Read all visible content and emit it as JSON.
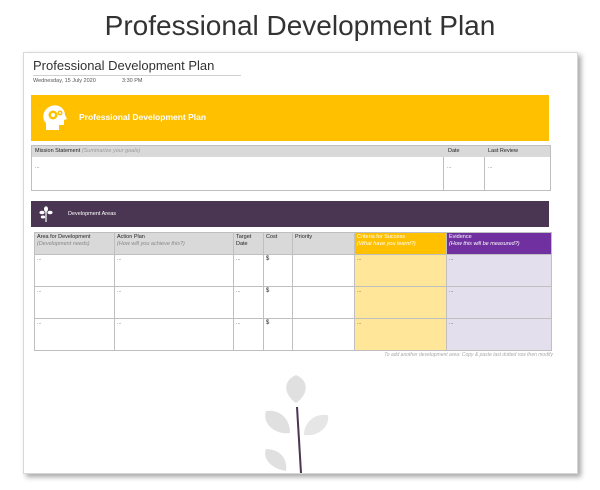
{
  "slide": {
    "title": "Professional Development Plan"
  },
  "doc": {
    "title": "Professional Development Plan",
    "date": "Wednesday, 15 July 2020",
    "time": "3:30 PM"
  },
  "banner": {
    "title": "Professional Development Plan",
    "icon": "head-gears-icon"
  },
  "mission": {
    "label": "Mission Statement",
    "hint": "(Summarize your goals)",
    "date_label": "Date",
    "review_label": "Last Review",
    "statement_value": "...",
    "date_value": "...",
    "review_value": "..."
  },
  "dev": {
    "title": "Development Areas",
    "icon": "tree-icon",
    "columns": [
      {
        "label": "Area for Development",
        "hint": "(Development needs)"
      },
      {
        "label": "Action Plan",
        "hint": "(How will you achieve this?)"
      },
      {
        "label": "Target Date",
        "hint": ""
      },
      {
        "label": "Cost",
        "hint": ""
      },
      {
        "label": "Priority",
        "hint": ""
      },
      {
        "label": "Criteria for Success",
        "hint": "(What have you learnt?)"
      },
      {
        "label": "Evidence",
        "hint": "(How this will be measured?)"
      }
    ],
    "rows": [
      [
        "...",
        "...",
        "...",
        "$",
        "",
        "...",
        "..."
      ],
      [
        "...",
        "...",
        "...",
        "$",
        "",
        "...",
        "..."
      ],
      [
        "...",
        "...",
        "...",
        "$",
        "",
        "...",
        "..."
      ]
    ],
    "footnote": "To add another development area: Copy & paste last dotted row then modify"
  },
  "colors": {
    "gold": "#ffc000",
    "purple": "#7030a0",
    "dark_purple": "#4a3553"
  }
}
